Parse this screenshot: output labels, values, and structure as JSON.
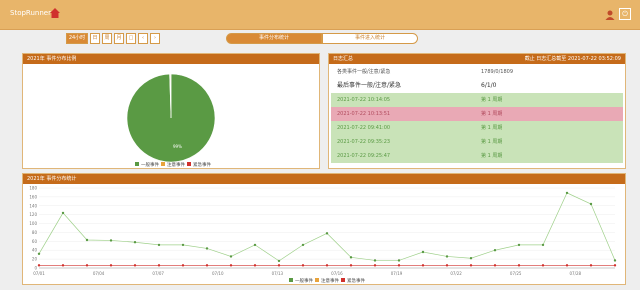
{
  "app": {
    "title": "StopRunner"
  },
  "toolbar": {
    "active": "24小时",
    "buttons": [
      "日",
      "周",
      "月",
      "□",
      "‹",
      "›"
    ]
  },
  "views": {
    "left": "事件分布统计",
    "right": "事件进入统计"
  },
  "panels": {
    "pie": {
      "title": "2021年 事件分布比例",
      "legend": [
        "一般事件",
        "注意事件",
        "紧急事件"
      ]
    },
    "list": {
      "title": "日志汇总",
      "right_text": "截止 日志汇总截至 2021-07-22 03:52:09",
      "header": [
        "各类事件一般/注意/紧急",
        "1789/0/1809"
      ],
      "sub": [
        "最后事件一般/注意/紧急",
        "6/1/0"
      ],
      "rows": [
        {
          "time": "2021-07-22 10:14:05",
          "val": "第 1 周期"
        },
        {
          "time": "2021-07-22 10:13:51",
          "val": "第 1 周期"
        },
        {
          "time": "2021-07-22 09:41:00",
          "val": "第 1 周期"
        },
        {
          "time": "2021-07-22 09:35:23",
          "val": "第 1 周期"
        },
        {
          "time": "2021-07-22 09:25:47",
          "val": "第 1 周期"
        }
      ]
    },
    "line": {
      "title": "2021年 事件分布统计",
      "legend": [
        "一般事件",
        "注意事件",
        "紧急事件"
      ]
    }
  },
  "colors": {
    "general": "#5a9a44",
    "notice": "#e8a33c",
    "urgent": "#d0312d",
    "accent": "#c56b1a"
  },
  "chart_data": [
    {
      "type": "pie",
      "slices": [
        {
          "name": "一般事件",
          "value": 99.5
        },
        {
          "name": "注意事件",
          "value": 0.3
        },
        {
          "name": "紧急事件",
          "value": 0.2
        }
      ],
      "data_label": "99%"
    },
    {
      "type": "line",
      "x": [
        "07/01",
        "07/02",
        "07/03",
        "07/04",
        "07/05",
        "07/06",
        "07/07",
        "07/08",
        "07/09",
        "07/10",
        "07/11",
        "07/12",
        "07/13",
        "07/14",
        "07/15",
        "07/16",
        "07/17",
        "07/18",
        "07/19",
        "07/20",
        "07/21",
        "07/22",
        "07/23",
        "07/24",
        "07/25",
        "07/26",
        "07/27",
        "07/28",
        "07/29",
        "07/30"
      ],
      "xticks": [
        "07/01",
        "07/04",
        "07/07",
        "07/10",
        "07/13",
        "07/16",
        "07/19",
        "07/22",
        "07/25",
        "07/28"
      ],
      "ylim": [
        0,
        180
      ],
      "yticks": [
        0,
        20,
        40,
        60,
        80,
        100,
        120,
        140,
        160,
        180
      ],
      "series": [
        {
          "name": "一般事件",
          "values": [
            32,
            124,
            63,
            62,
            58,
            52,
            52,
            44,
            26,
            52,
            16,
            52,
            78,
            24,
            17,
            17,
            36,
            26,
            22,
            40,
            52,
            52,
            169,
            144,
            17
          ]
        },
        {
          "name": "紧急事件",
          "values": [
            6,
            6,
            6,
            6,
            6,
            6,
            6,
            6,
            6,
            6,
            6,
            6,
            6,
            6,
            6,
            6,
            6,
            6,
            6,
            6,
            6,
            6,
            6,
            6,
            6
          ]
        }
      ]
    }
  ]
}
